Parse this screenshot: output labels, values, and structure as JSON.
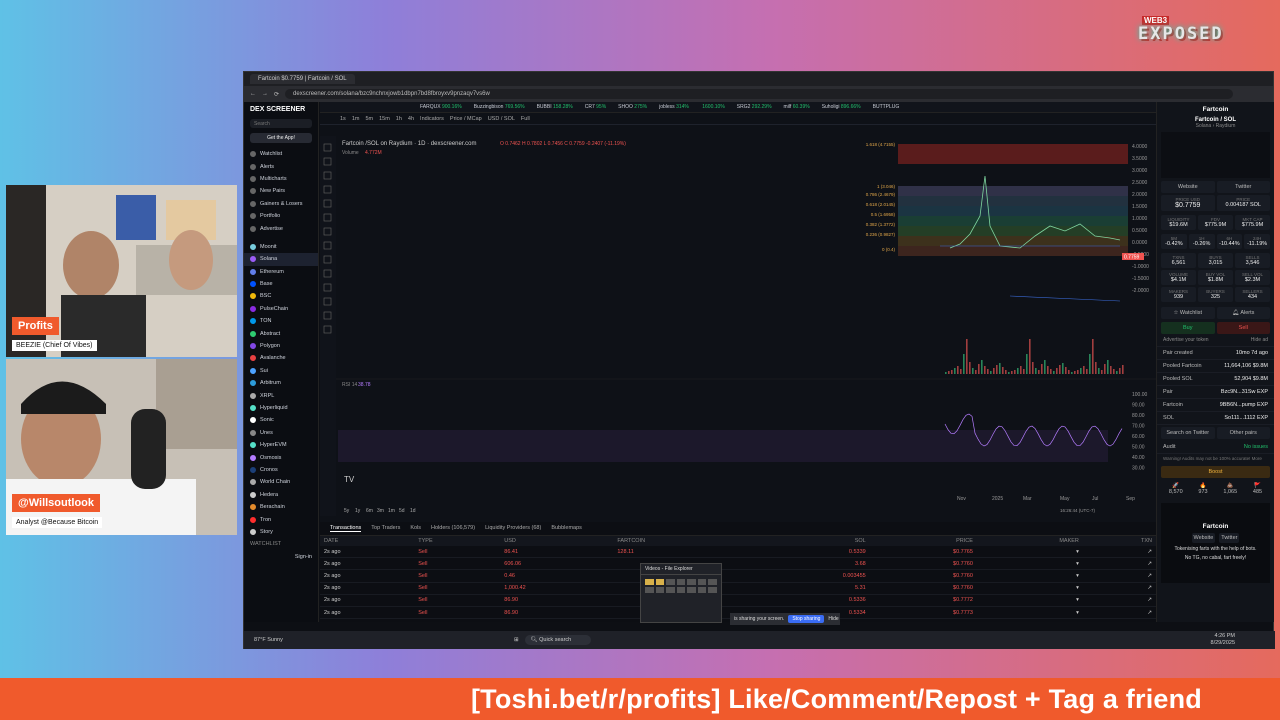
{
  "overlay": {
    "logo_top": "WEB3",
    "logo_main": "EXPOSED",
    "banner": "[Toshi.bet/r/profits] Like/Comment/Repost + Tag a friend",
    "cam1_tag": "Profits",
    "cam1_sub": "BEEZIE (Chief Of Vibes)",
    "cam2_tag": "@Willsoutlook",
    "cam2_sub": "Analyst @Because Bitcoin"
  },
  "browser": {
    "tab_title": "Fartcoin $0.7759 | Fartcoin / SOL",
    "url": "dexscreener.com/solana/bzc9nchnxjowb1dbpn7bd8fbroyxv9pnzaqv7vs6w"
  },
  "sidebar": {
    "brand": "DEX SCREENER",
    "search": "Search",
    "get_app": "Get the App!",
    "items": [
      "Watchlist",
      "Alerts",
      "Multicharts",
      "New Pairs",
      "Gainers & Losers",
      "Portfolio",
      "Advertise"
    ],
    "chains": [
      "Moonit",
      "Solana",
      "Ethereum",
      "Base",
      "BSC",
      "PulseChain",
      "TON",
      "Abstract",
      "Polygon",
      "Avalanche",
      "Sui",
      "Arbitrum",
      "XRPL",
      "Hyperliquid",
      "Sonic",
      "Unes",
      "HyperEVM",
      "Osmosis",
      "Cronos",
      "World Chain",
      "Hedera",
      "Berachain",
      "Tron",
      "Story"
    ],
    "watchlist": "WATCHLIST",
    "footer": "Sign-in"
  },
  "ticker": [
    {
      "name": "FARQUX",
      "chg": "900.16%",
      "dir": "up"
    },
    {
      "name": "Buzzingbison",
      "chg": "769.56%",
      "dir": "up"
    },
    {
      "name": "BUBBI",
      "chg": "158.28%",
      "dir": "up"
    },
    {
      "name": "CR7",
      "chg": "95%",
      "dir": "up"
    },
    {
      "name": "SHOO",
      "chg": "275%",
      "dir": "up"
    },
    {
      "name": "jobless",
      "chg": "314%",
      "dir": "up"
    },
    {
      "name": "",
      "chg": "1600.10%",
      "dir": "up"
    },
    {
      "name": "SRG2",
      "chg": "292.29%",
      "dir": "up"
    },
    {
      "name": "milf",
      "chg": "60.39%",
      "dir": "up"
    },
    {
      "name": "Suholigi",
      "chg": "896.66%",
      "dir": "up"
    },
    {
      "name": "BUTTPLUG",
      "chg": "",
      "dir": "up"
    }
  ],
  "toolbar": {
    "intervals": [
      "1s",
      "1m",
      "5m",
      "15m",
      "1h",
      "4h"
    ],
    "indicators": "Indicators",
    "price_mcap": "Price / MCap",
    "usd_sol": "USD / SOL",
    "full": "Full"
  },
  "chart": {
    "title": "Fartcoin /SOL on Raydium · 1D · dexscreener.com",
    "ohlc": "O 0.7462  H 0.7802  L 0.7456  C 0.7759  -0.2407 (-11.19%)",
    "volume_label": "Volume",
    "volume_val": "4.772M",
    "rsi_label": "RSI 14",
    "rsi_val": "38.78",
    "price_ticks": [
      "4.0000",
      "3.5000",
      "3.0000",
      "2.5000",
      "2.0000",
      "1.5000",
      "1.0000",
      "0.5000",
      "0.0000",
      "-0.5000",
      "-1.0000",
      "-1.5000",
      "-2.0000"
    ],
    "rsi_ticks": [
      "100.00",
      "90.00",
      "80.00",
      "70.00",
      "60.00",
      "50.00",
      "40.00",
      "30.00"
    ],
    "time_ticks": [
      "Nov",
      "2025",
      "Mar",
      "May",
      "Jul",
      "Sep"
    ],
    "current_price": "0.7759",
    "clock": "16:26:44 (UTC-7)",
    "fib_levels": [
      "1 (3.046)",
      "0.786 (2.4679)",
      "0.618 (2.0145)",
      "0.5 (1.6958)",
      "0.382 (1.3772)",
      "0.236 (0.9827)",
      "0 (0.4)",
      "1.618 (4.7155)"
    ],
    "ranges": [
      "5y",
      "1y",
      "6m",
      "3m",
      "1m",
      "5d",
      "1d"
    ]
  },
  "bottom": {
    "tabs": [
      "Transactions",
      "Top Traders",
      "Kols",
      "Holders (106,579)",
      "Liquidity Providers (68)",
      "Bubblemaps"
    ],
    "columns": [
      "DATE",
      "TYPE",
      "USD",
      "FARTCOIN",
      "SOL",
      "PRICE",
      "MAKER",
      "TXN"
    ],
    "rows": [
      {
        "date": "2s ago",
        "type": "Sell",
        "usd": "86.41",
        "fart": "128.11",
        "sol": "0.5339",
        "price": "$0.7765"
      },
      {
        "date": "2s ago",
        "type": "Sell",
        "usd": "606.06",
        "fart": "",
        "sol": "3.68",
        "price": "$0.7760"
      },
      {
        "date": "2s ago",
        "type": "Sell",
        "usd": "0.46",
        "fart": "",
        "sol": "0.003455",
        "price": "$0.7760"
      },
      {
        "date": "2s ago",
        "type": "Sell",
        "usd": "1,000.42",
        "fart": "",
        "sol": "5.31",
        "price": "$0.7760"
      },
      {
        "date": "2s ago",
        "type": "Sell",
        "usd": "86.90",
        "fart": "",
        "sol": "0.5336",
        "price": "$0.7772"
      },
      {
        "date": "2s ago",
        "type": "Sell",
        "usd": "86.90",
        "fart": "",
        "sol": "0.5334",
        "price": "$0.7773"
      }
    ]
  },
  "right": {
    "name": "Fartcoin",
    "pair": "Fartcoin / SOL",
    "chain": "Solana",
    "dex": "Raydium",
    "website": "Website",
    "twitter": "Twitter",
    "price_usd_label": "PRICE USD",
    "price_usd": "$0.7759",
    "price_sol_label": "PRICE",
    "price_sol": "0.004187 SOL",
    "liq_label": "LIQUIDITY",
    "liq": "$19.6M",
    "fdv_label": "FDV",
    "fdv": "$775.9M",
    "mcap_label": "MKT CAP",
    "mcap": "$775.9M",
    "changes": [
      {
        "l": "5M",
        "v": "-0.42%"
      },
      {
        "l": "1H",
        "v": "-0.26%"
      },
      {
        "l": "6H",
        "v": "-10.44%"
      },
      {
        "l": "24H",
        "v": "-11.19%"
      }
    ],
    "stats": [
      {
        "l": "TXNS",
        "v": "6,561"
      },
      {
        "l": "BUYS",
        "v": "3,015"
      },
      {
        "l": "SELLS",
        "v": "3,546"
      },
      {
        "l": "VOLUME",
        "v": "$4.1M"
      },
      {
        "l": "BUY VOL",
        "v": "$1.8M"
      },
      {
        "l": "SELL VOL",
        "v": "$2.3M"
      },
      {
        "l": "MAKERS",
        "v": "939"
      },
      {
        "l": "BUYERS",
        "v": "325"
      },
      {
        "l": "SELLERS",
        "v": "434"
      }
    ],
    "watchlist": "Watchlist",
    "alerts": "Alerts",
    "buy": "Buy",
    "sell": "Sell",
    "advertise": "Advertise your token",
    "hide_ad": "Hide ad",
    "info": [
      {
        "l": "Pair created",
        "v": "10mo 7d ago"
      },
      {
        "l": "Pooled Fartcoin",
        "v": "11,664,106  $9.8M"
      },
      {
        "l": "Pooled SOL",
        "v": "52,904  $9.8M"
      },
      {
        "l": "Pair",
        "v": "Bzc9N...31Sw  EXP"
      },
      {
        "l": "Fartcoin",
        "v": "9BB6N...pump  EXP"
      },
      {
        "l": "SOL",
        "v": "So111...1112  EXP"
      }
    ],
    "search_twitter": "Search on Twitter",
    "other_pairs": "Other pairs",
    "audit_label": "Audit",
    "audit_value": "No issues",
    "audit_note": "Warning! Audits may not be 100% accurate!",
    "more": "More",
    "boost": "Boost",
    "reactions": [
      "8,570",
      "973",
      "1,065",
      "485"
    ],
    "footer_name": "Fartcoin",
    "footer_desc": "Tokenising farts with the help of bots.",
    "footer_desc2": "No TG, no cabal, fart freely!"
  },
  "taskbar": {
    "weather": "87°F",
    "weather_sub": "Sunny",
    "search": "Quick search",
    "time": "4:26 PM",
    "date": "8/29/2025"
  },
  "popup": {
    "fileexp": "Videos - File Explorer",
    "share": "is sharing your screen.",
    "stop": "Stop sharing",
    "hide": "Hide"
  }
}
